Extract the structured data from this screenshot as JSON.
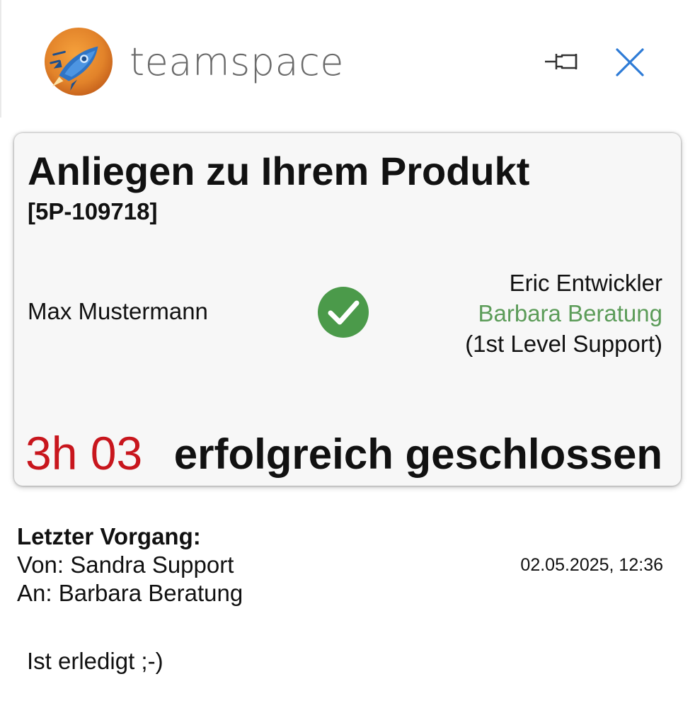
{
  "header": {
    "app_name": "teamspace",
    "pin_icon": "pin-icon",
    "close_icon": "close-icon",
    "accent_color": "#2e7bd6"
  },
  "ticket": {
    "title": "Anliegen zu Ihrem Produkt",
    "id": "[5P-109718]",
    "customer": "Max Mustermann",
    "status_icon": "check-circle-icon",
    "status_icon_color": "#4b9a4a",
    "assignees": {
      "developer": "Eric Entwickler",
      "advisor": "Barbara Beratung",
      "role": "(1st Level Support)"
    },
    "advisor_color": "#5c9c59",
    "duration": "3h 03",
    "duration_color": "#c8161d",
    "status": "erfolgreich geschlossen"
  },
  "last_action": {
    "heading": "Letzter Vorgang:",
    "from": "Von: Sandra Support",
    "to": "An: Barbara Beratung",
    "timestamp": "02.05.2025, 12:36",
    "message": "Ist erledigt ;-)"
  }
}
